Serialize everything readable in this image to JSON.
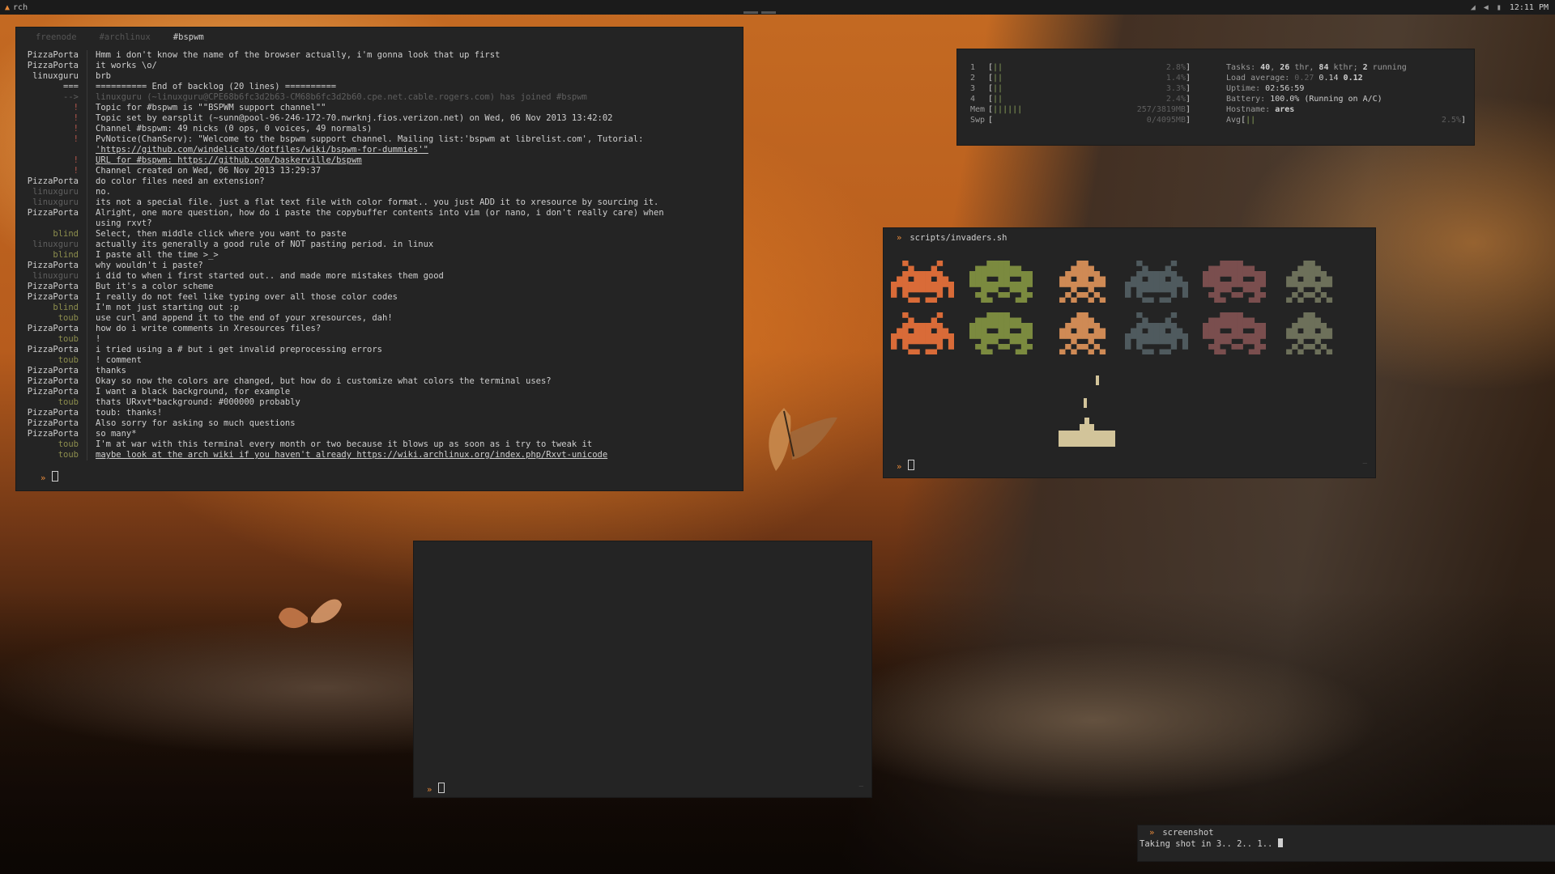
{
  "topbar": {
    "workspace": "rch",
    "clock": "12:11 PM",
    "status_icons": [
      "network-icon",
      "volume-icon",
      "battery-icon"
    ]
  },
  "irc": {
    "tabs": [
      {
        "label": "freenode",
        "active": false
      },
      {
        "label": "#archlinux",
        "active": false
      },
      {
        "label": "#bspwm",
        "active": true
      }
    ],
    "lines": [
      {
        "nick": "PizzaPorta",
        "msg": "Hmm i don't know the name of the browser actually, i'm gonna look that up first"
      },
      {
        "nick": "PizzaPorta",
        "msg": "it works \\o/"
      },
      {
        "nick": "linuxguru",
        "msg": "brb"
      },
      {
        "nick": "===",
        "msg": "========== End of backlog (20 lines) =========="
      },
      {
        "nick": "-->",
        "msg": "linuxguru (~linuxguru@CPE68b6fc3d2b63-CM68b6fc3d2b60.cpe.net.cable.rogers.com) has joined #bspwm"
      },
      {
        "nick": "!",
        "msg": "Topic for #bspwm is \"\"BSPWM support channel\"\""
      },
      {
        "nick": "!",
        "msg": "Topic set by earsplit (~sunn@pool-96-246-172-70.nwrknj.fios.verizon.net) on Wed, 06 Nov 2013 13:42:02"
      },
      {
        "nick": "!",
        "msg": "Channel #bspwm: 49 nicks (0 ops, 0 voices, 49 normals)"
      },
      {
        "nick": "!",
        "msg": "PvNotice(ChanServ): \"Welcome to the bspwm support channel. Mailing list:'bspwm at librelist.com', Tutorial:"
      },
      {
        "nick": "",
        "msg": "'https://github.com/windelicato/dotfiles/wiki/bspwm-for-dummies'\""
      },
      {
        "nick": "!",
        "msg": "URL for #bspwm: https://github.com/baskerville/bspwm"
      },
      {
        "nick": "!",
        "msg": "Channel created on Wed, 06 Nov 2013 13:29:37"
      },
      {
        "nick": "PizzaPorta",
        "msg": "do color files need an extension?"
      },
      {
        "nick": "linuxguru",
        "msg": "no."
      },
      {
        "nick": "linuxguru",
        "msg": "its not a special file. just a flat text file with color format.. you just ADD it to xresource by sourcing it."
      },
      {
        "nick": "PizzaPorta",
        "msg": "Alright, one more question, how do i paste the copybuffer contents into vim (or nano, i don't really care) when"
      },
      {
        "nick": "",
        "msg": "using rxvt?"
      },
      {
        "nick": "blind",
        "msg": "Select, then middle click where you want to paste"
      },
      {
        "nick": "linuxguru",
        "msg": "actually its generally a good rule of NOT pasting period. in linux"
      },
      {
        "nick": "blind",
        "msg": "I paste all the time >_>"
      },
      {
        "nick": "PizzaPorta",
        "msg": "why wouldn't i paste?"
      },
      {
        "nick": "linuxguru",
        "msg": "i did to when i first started out.. and made more mistakes them good"
      },
      {
        "nick": "PizzaPorta",
        "msg": "But it's a color scheme"
      },
      {
        "nick": "PizzaPorta",
        "msg": "I really do not feel like typing over all those color codes"
      },
      {
        "nick": "blind",
        "msg": "I'm not just starting out :p"
      },
      {
        "nick": "toub",
        "msg": "use curl and append it to the end of your xresources, dah!"
      },
      {
        "nick": "PizzaPorta",
        "msg": "how do i write comments in Xresources files?"
      },
      {
        "nick": "toub",
        "msg": "!"
      },
      {
        "nick": "PizzaPorta",
        "msg": "i tried using a # but i get invalid preprocessing errors"
      },
      {
        "nick": "toub",
        "msg": "! comment"
      },
      {
        "nick": "PizzaPorta",
        "msg": "thanks"
      },
      {
        "nick": "PizzaPorta",
        "msg": "Okay so now the colors are changed, but how do i customize what colors the terminal uses?"
      },
      {
        "nick": "PizzaPorta",
        "msg": "I want a black background, for example"
      },
      {
        "nick": "toub",
        "msg": "thats URxvt*background: #000000 probably"
      },
      {
        "nick": "PizzaPorta",
        "msg": "toub: thanks!"
      },
      {
        "nick": "PizzaPorta",
        "msg": "Also sorry for asking so much questions"
      },
      {
        "nick": "PizzaPorta",
        "msg": "so many*"
      },
      {
        "nick": "toub",
        "msg": "I'm at war with this terminal every month or two because it blows up as soon as i try to tweak it"
      },
      {
        "nick": "toub",
        "msg": "maybe look at the arch wiki if you haven't already https://wiki.archlinux.org/index.php/Rxvt-unicode"
      }
    ],
    "prompt": "»"
  },
  "htop": {
    "cpus": [
      {
        "label": "1",
        "bars": "||",
        "pct": "2.8%"
      },
      {
        "label": "2",
        "bars": "||",
        "pct": "1.4%"
      },
      {
        "label": "3",
        "bars": "||",
        "pct": "3.3%"
      },
      {
        "label": "4",
        "bars": "||",
        "pct": "2.4%"
      }
    ],
    "mem": {
      "label": "Mem",
      "bars": "||||||",
      "value": "257/3819MB"
    },
    "swp": {
      "label": "Swp",
      "bars": "",
      "value": "0/4095MB"
    },
    "tasks_label": "Tasks: ",
    "tasks": "40",
    "thr_sep": ", ",
    "thr": "26",
    "thr_label": " thr, ",
    "kthr": "84",
    "kthr_label": " kthr; ",
    "running": "2",
    "running_label": " running",
    "load_label": "Load average: ",
    "load1": "0.27",
    "load5": "0.14",
    "load15": "0.12",
    "uptime_label": "Uptime: ",
    "uptime": "02:56:59",
    "battery_label": "Battery: ",
    "battery": "100.0%",
    "battery_note": " (Running on A/C)",
    "hostname_label": "Hostname: ",
    "hostname": "ares",
    "avg": {
      "label": "Avg",
      "bars": "||",
      "pct": "2.5%"
    }
  },
  "invaders": {
    "title": "scripts/invaders.sh",
    "prompt": "»",
    "colors": [
      "#d96b38",
      "#7b8a3f",
      "#cf8a55",
      "#4f5a5e",
      "#7a4e4e",
      "#6d705a"
    ],
    "cannon_color": "#d2c49a",
    "tiny": "—"
  },
  "blank": {
    "prompt": "»",
    "tiny": "—"
  },
  "screenshot": {
    "command": "screenshot",
    "output": "Taking shot in 3.. 2.. 1.. "
  }
}
